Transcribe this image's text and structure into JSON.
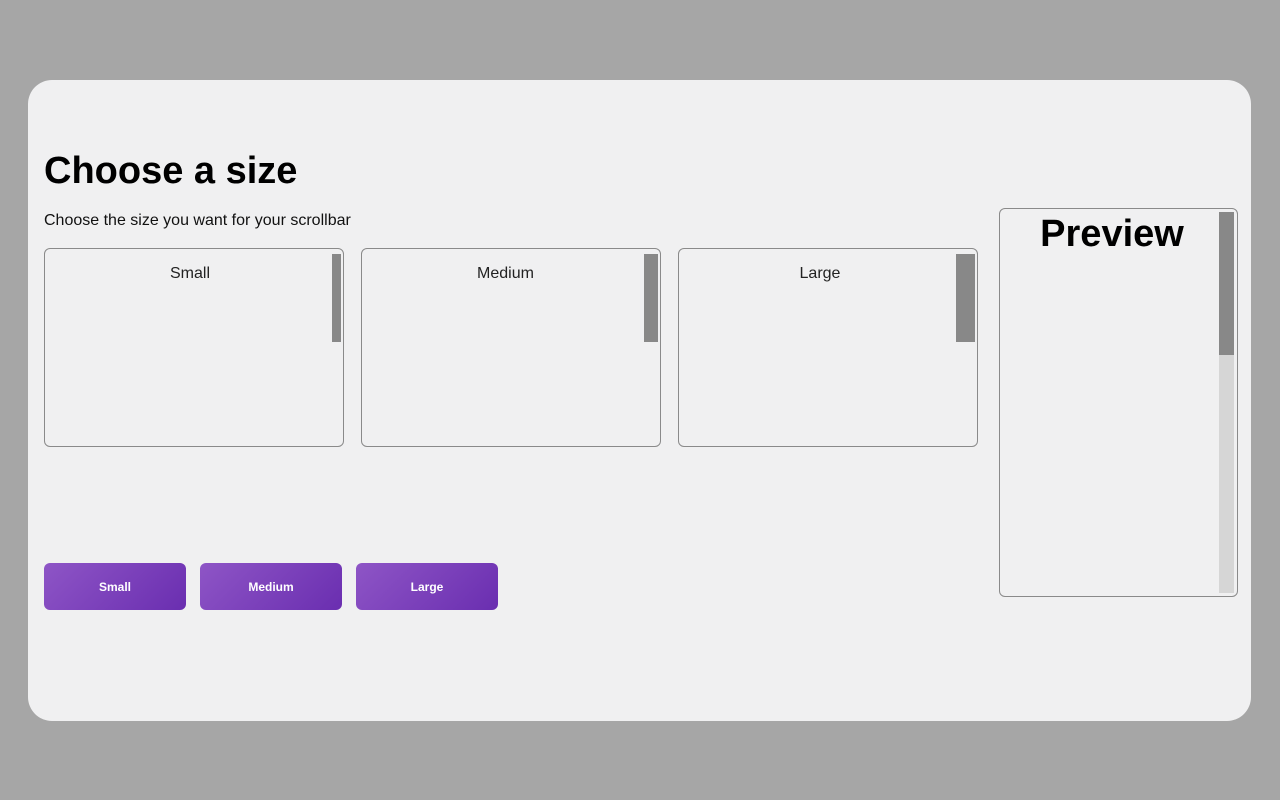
{
  "page": {
    "title": "Choose a size",
    "subtitle": "Choose the size you want for your scrollbar"
  },
  "cards": [
    {
      "label": "Small"
    },
    {
      "label": "Medium"
    },
    {
      "label": "Large"
    }
  ],
  "buttons": [
    {
      "label": "Small"
    },
    {
      "label": "Medium"
    },
    {
      "label": "Large"
    }
  ],
  "preview": {
    "title": "Preview"
  },
  "colors": {
    "backdrop": "#a6a6a6",
    "panel": "#f0f0f1",
    "scrollbar_thumb": "#888888",
    "scrollbar_track": "#d6d6d6",
    "button_gradient_start": "#8e55c6",
    "button_gradient_end": "#6a2eb0"
  }
}
